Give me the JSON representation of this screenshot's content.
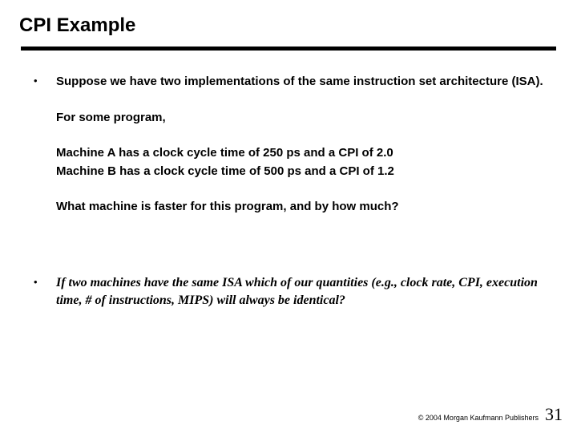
{
  "title": "CPI Example",
  "bullets": [
    {
      "paragraphs": [
        "Suppose we have two implementations of the same instruction set architecture (ISA).",
        "For some program,",
        "Machine A has a clock cycle time of 250 ps and a CPI of 2.0\nMachine B has a clock cycle time of 500 ps and a CPI of 1.2",
        "What machine is faster for this program, and by how much?"
      ],
      "italic": false
    },
    {
      "paragraphs": [
        "If two machines have the same ISA which of our quantities (e.g., clock rate, CPI, execution time, # of instructions, MIPS) will always be identical?"
      ],
      "italic": true
    }
  ],
  "footer": {
    "copyright": "© 2004 Morgan Kaufmann Publishers",
    "page": "31"
  }
}
